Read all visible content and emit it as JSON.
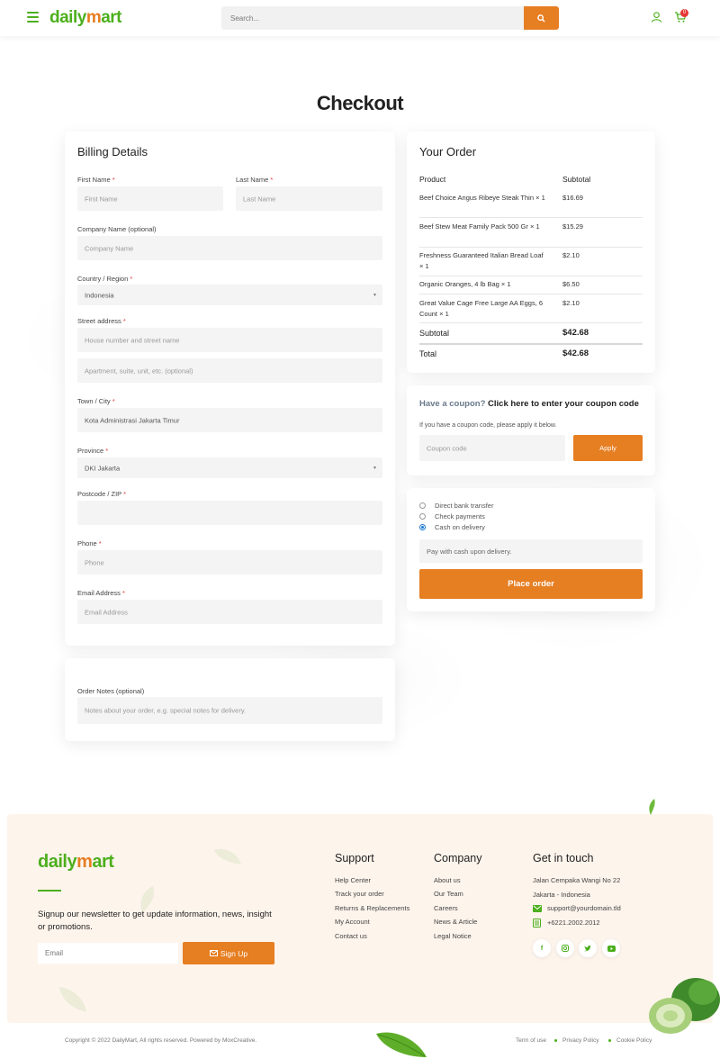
{
  "colors": {
    "accent": "#e67e22",
    "brand_green": "#4caf1d",
    "required": "#e53935"
  },
  "header": {
    "logo_daily": "daily",
    "logo_m": "m",
    "logo_art": "art",
    "search_placeholder": "Search...",
    "cart_count": "0",
    "icons": [
      "menu-icon",
      "search-icon",
      "user-icon",
      "cart-icon"
    ]
  },
  "page_title": "Checkout",
  "billing": {
    "title": "Billing Details",
    "required_mark": "*",
    "first_name_label": "First Name",
    "first_name_placeholder": "First Name",
    "last_name_label": "Last Name",
    "last_name_placeholder": "Last Name",
    "company_label": "Company Name (optional)",
    "company_placeholder": "Company Name",
    "country_label": "Country / Region",
    "country_value": "Indonesia",
    "street_label": "Street address",
    "street_placeholder1": "House number and street name",
    "street_placeholder2": "Apartment, suite, unit, etc. (optional)",
    "town_label": "Town / City",
    "town_value": "Kota Administrasi Jakarta Timur",
    "province_label": "Province",
    "province_value": "DKI Jakarta",
    "postcode_label": "Postcode / ZIP",
    "postcode_value": "",
    "phone_label": "Phone",
    "phone_placeholder": "Phone",
    "email_label": "Email Address",
    "email_placeholder": "Email Address"
  },
  "notes": {
    "label": "Order Notes (optional)",
    "placeholder": "Notes about your order, e.g. special notes for delivery."
  },
  "order": {
    "title": "Your Order",
    "col_product": "Product",
    "col_subtotal": "Subtotal",
    "items": [
      {
        "name": "Beef Choice Angus Ribeye Steak Thin",
        "qty": "× 1",
        "price": "$16.69"
      },
      {
        "name": "Beef Stew Meat Family Pack 500 Gr",
        "qty": "× 1",
        "price": "$15.29"
      },
      {
        "name": "Freshness Guaranteed Italian Bread Loaf",
        "qty": "× 1",
        "price": "$2.10"
      },
      {
        "name": "Organic Oranges, 4 lb Bag",
        "qty": "× 1",
        "price": "$6.50"
      },
      {
        "name": "Great Value Cage Free Large AA Eggs, 6 Count",
        "qty": "× 1",
        "price": "$2.10"
      }
    ],
    "subtotal_label": "Subtotal",
    "subtotal_value": "$42.68",
    "total_label": "Total",
    "total_value": "$42.68"
  },
  "coupon": {
    "question": "Have a coupon?",
    "link": "Click here to enter your coupon code",
    "hint": "If you have a coupon code, please apply it below.",
    "placeholder": "Coupon code",
    "apply": "Apply"
  },
  "payment": {
    "methods": [
      {
        "label": "Direct bank transfer",
        "selected": false
      },
      {
        "label": "Check payments",
        "selected": false
      },
      {
        "label": "Cash on delivery",
        "selected": true
      }
    ],
    "description": "Pay with cash upon delivery.",
    "place_order": "Place order"
  },
  "footer": {
    "logo_daily": "daily",
    "logo_m": "m",
    "logo_art": "art",
    "newsletter": "Signup our newsletter to get update information, news, insight or promotions.",
    "email_placeholder": "Email",
    "signup": "Sign Up",
    "support_title": "Support",
    "support_links": [
      "Help Center",
      "Track your order",
      "Returns & Replacements",
      "My Account",
      "Contact us"
    ],
    "company_title": "Company",
    "company_links": [
      "About us",
      "Our Team",
      "Careers",
      "News & Article",
      "Legal Notice"
    ],
    "contact_title": "Get in touch",
    "address1": "Jalan Cempaka Wangi No 22",
    "address2": "Jakarta - Indonesia",
    "email": "support@yourdomain.tld",
    "phone": "+6221.2002.2012",
    "social_icons": [
      "facebook-icon",
      "instagram-icon",
      "twitter-icon",
      "youtube-icon"
    ],
    "copyright": "Copyright © 2022 DailyMart, All rights reserved. Powered by MoxCreative.",
    "legal_links": [
      "Term of use",
      "Privacy Policy",
      "Cookie Policy"
    ]
  }
}
